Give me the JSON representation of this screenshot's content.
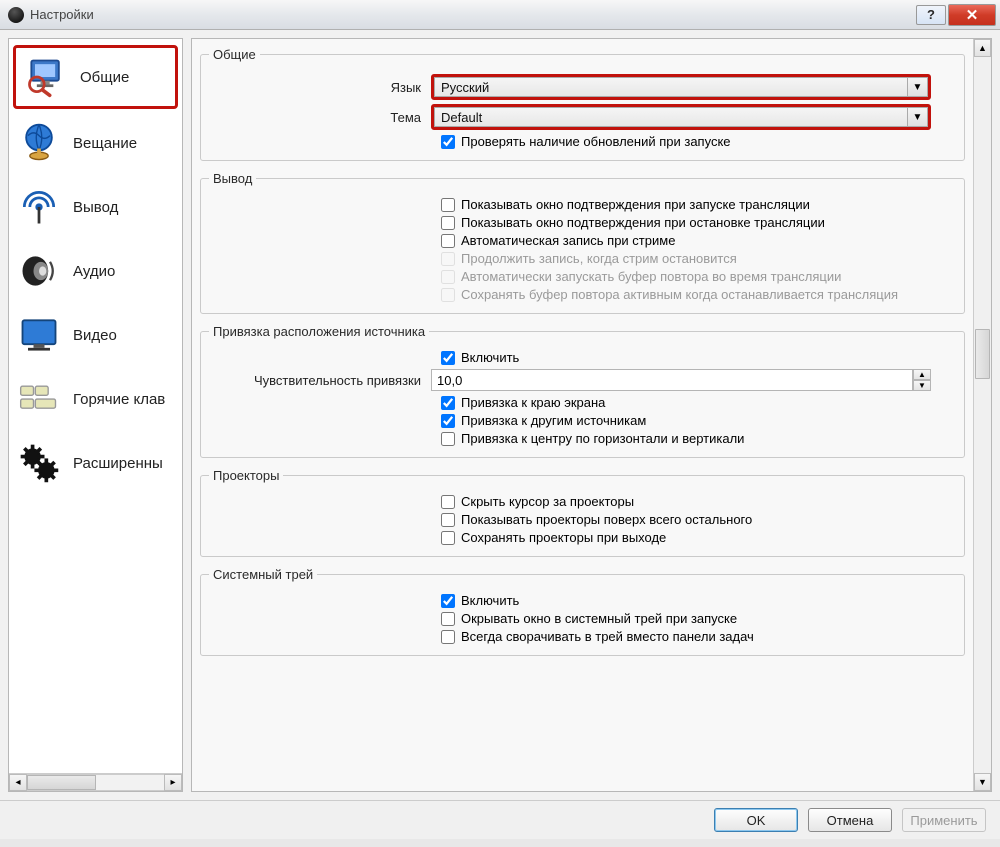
{
  "window": {
    "title": "Настройки"
  },
  "sidebar": {
    "items": [
      {
        "label": "Общие"
      },
      {
        "label": "Вещание"
      },
      {
        "label": "Вывод"
      },
      {
        "label": "Аудио"
      },
      {
        "label": "Видео"
      },
      {
        "label": "Горячие клав"
      },
      {
        "label": "Расширенны"
      }
    ]
  },
  "sections": {
    "general": {
      "legend": "Общие",
      "language_label": "Язык",
      "language_value": "Русский",
      "theme_label": "Тема",
      "theme_value": "Default",
      "check_updates": "Проверять наличие обновлений при запуске"
    },
    "output": {
      "legend": "Вывод",
      "opt1": "Показывать окно подтверждения при запуске трансляции",
      "opt2": "Показывать окно подтверждения при остановке трансляции",
      "opt3": "Автоматическая запись при стриме",
      "opt4": "Продолжить запись, когда стрим остановится",
      "opt5": "Автоматически запускать буфер повтора во время трансляции",
      "opt6": "Сохранять буфер повтора активным когда останавливается трансляция"
    },
    "snapping": {
      "legend": "Привязка расположения источника",
      "enable": "Включить",
      "sensitivity_label": "Чувствительность привязки",
      "sensitivity_value": "10,0",
      "snap_edge": "Привязка к краю экрана",
      "snap_sources": "Привязка к другим источникам",
      "snap_center": "Привязка к центру по горизонтали и вертикали"
    },
    "projectors": {
      "legend": "Проекторы",
      "opt1": "Скрыть курсор за проекторы",
      "opt2": "Показывать проекторы поверх всего остального",
      "opt3": "Сохранять проекторы при выходе"
    },
    "tray": {
      "legend": "Системный трей",
      "enable": "Включить",
      "opt2": "Окрывать окно в системный трей при запуске",
      "opt3": "Всегда сворачивать в трей вместо панели задач"
    }
  },
  "footer": {
    "ok": "OK",
    "cancel": "Отмена",
    "apply": "Применить"
  }
}
